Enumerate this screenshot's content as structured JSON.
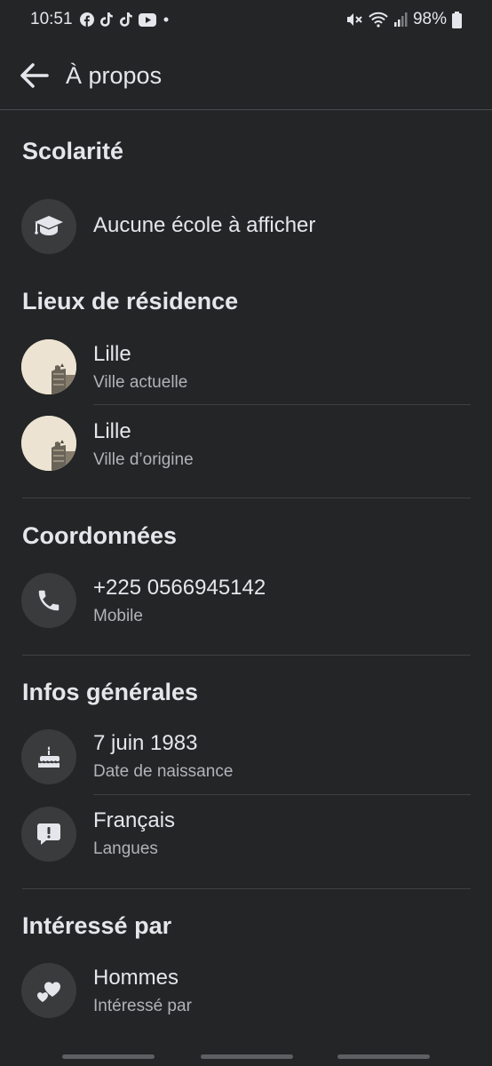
{
  "status_bar": {
    "time": "10:51",
    "battery": "98%",
    "app_icons": [
      "facebook-icon",
      "tiktok-icon",
      "tiktok-icon",
      "youtube-icon",
      "dot-icon"
    ],
    "system_icons": [
      "mute-icon",
      "wifi-icon",
      "signal-icon",
      "battery-icon"
    ]
  },
  "header": {
    "title": "À propos"
  },
  "sections": {
    "education": {
      "title": "Scolarité",
      "item": {
        "primary": "Aucune école à afficher",
        "icon": "graduation-cap-icon"
      }
    },
    "places": {
      "title": "Lieux de résidence",
      "items": [
        {
          "primary": "Lille",
          "secondary": "Ville actuelle"
        },
        {
          "primary": "Lille",
          "secondary": "Ville d’origine"
        }
      ]
    },
    "contact": {
      "title": "Coordonnées",
      "item": {
        "primary": "+225 0566945142",
        "secondary": "Mobile",
        "icon": "phone-icon"
      }
    },
    "general": {
      "title": "Infos générales",
      "items": [
        {
          "primary": "7 juin 1983",
          "secondary": "Date de naissance",
          "icon": "cake-icon"
        },
        {
          "primary": "Français",
          "secondary": "Langues",
          "icon": "language-bubble-icon"
        }
      ]
    },
    "interested": {
      "title": "Intéressé par",
      "item": {
        "primary": "Hommes",
        "secondary": "Intéressé par",
        "icon": "hearts-icon"
      }
    }
  },
  "colors": {
    "background": "#242526",
    "text_primary": "#e4e6eb",
    "text_secondary": "#b0b3b8",
    "icon_bg": "#3a3b3c",
    "divider": "#3e4042"
  }
}
